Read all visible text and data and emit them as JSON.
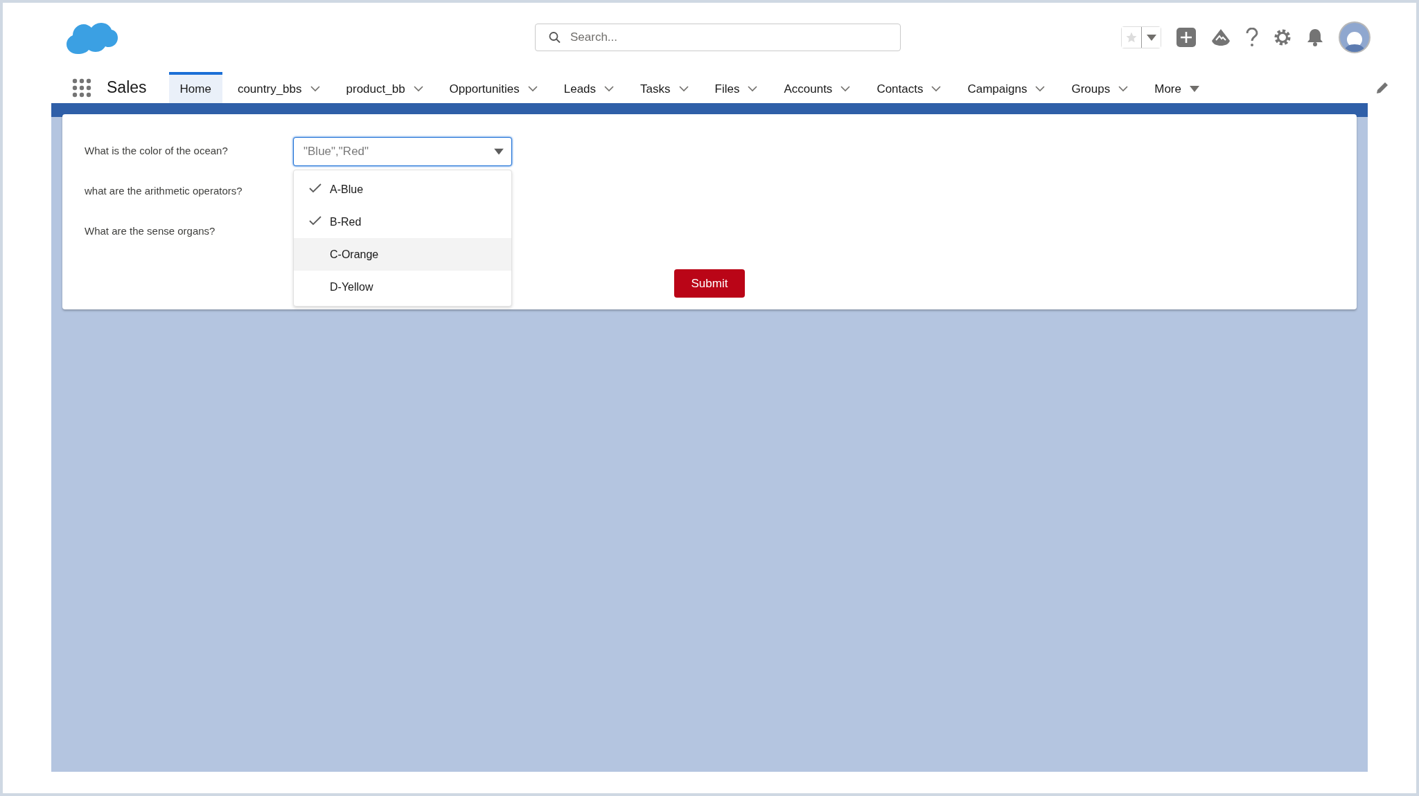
{
  "search": {
    "placeholder": "Search..."
  },
  "app_name": "Sales",
  "nav": [
    {
      "label": "Home",
      "selected": true,
      "kind": "plain"
    },
    {
      "label": "country_bbs",
      "selected": false,
      "kind": "dropdown"
    },
    {
      "label": "product_bb",
      "selected": false,
      "kind": "dropdown"
    },
    {
      "label": "Opportunities",
      "selected": false,
      "kind": "dropdown"
    },
    {
      "label": "Leads",
      "selected": false,
      "kind": "dropdown"
    },
    {
      "label": "Tasks",
      "selected": false,
      "kind": "dropdown"
    },
    {
      "label": "Files",
      "selected": false,
      "kind": "dropdown"
    },
    {
      "label": "Accounts",
      "selected": false,
      "kind": "dropdown"
    },
    {
      "label": "Contacts",
      "selected": false,
      "kind": "dropdown"
    },
    {
      "label": "Campaigns",
      "selected": false,
      "kind": "dropdown"
    },
    {
      "label": "Groups",
      "selected": false,
      "kind": "dropdown"
    },
    {
      "label": "More",
      "selected": false,
      "kind": "overflow"
    }
  ],
  "questions": [
    "What is the color of the ocean?",
    "what are the arithmetic operators?",
    "What are the sense organs?"
  ],
  "combobox": {
    "placeholder": "\"Blue\",\"Red\"",
    "expanded": true
  },
  "options": [
    {
      "label": "A-Blue",
      "checked": true,
      "highlighted": false
    },
    {
      "label": "B-Red",
      "checked": true,
      "highlighted": false
    },
    {
      "label": "C-Orange",
      "checked": false,
      "highlighted": true
    },
    {
      "label": "D-Yellow",
      "checked": false,
      "highlighted": false
    }
  ],
  "submit": "Submit"
}
